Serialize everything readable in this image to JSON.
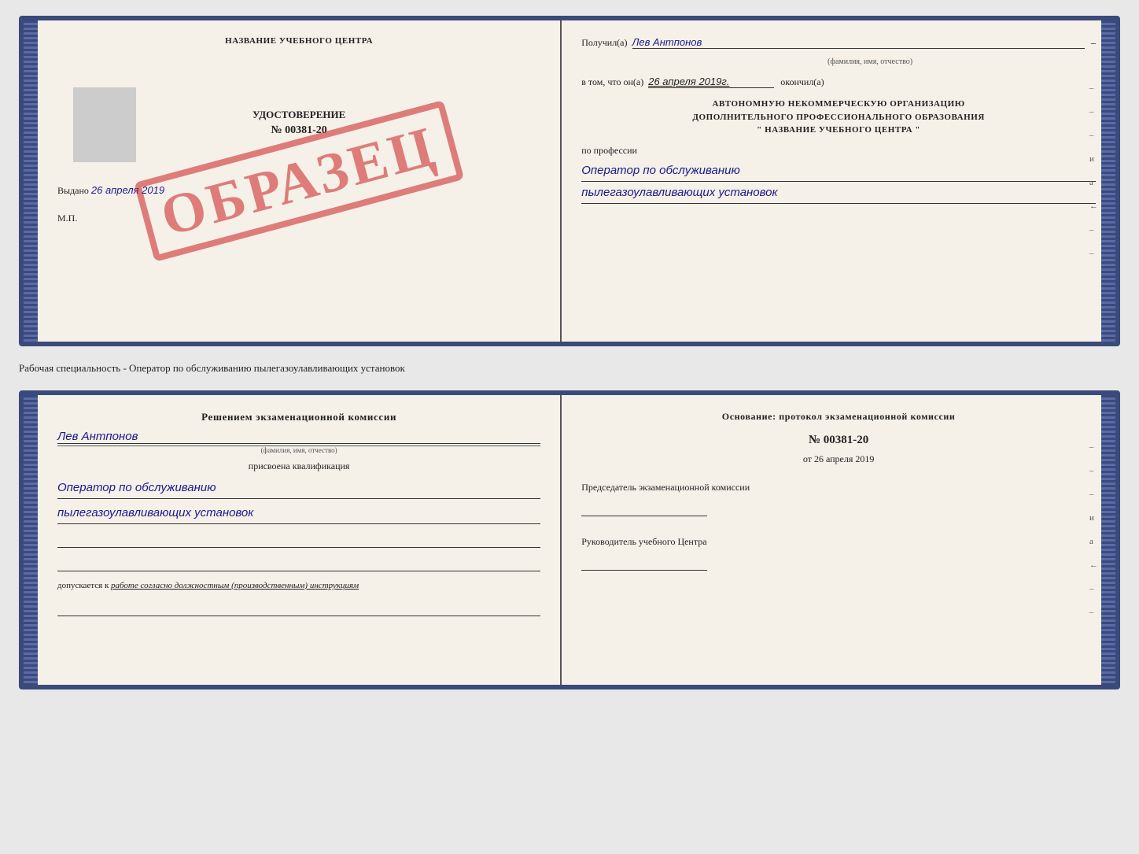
{
  "top_certificate": {
    "left": {
      "title": "НАЗВАНИЕ УЧЕБНОГО ЦЕНТРА",
      "stamp_text": "ОБРАЗЕЦ",
      "photo_placeholder": "",
      "udostoverenie": "УДОСТОВЕРЕНИЕ",
      "number": "№ 00381-20",
      "vydano_label": "Выдано",
      "vydano_date": "26 апреля 2019",
      "mp": "М.П."
    },
    "right": {
      "poluchil_label": "Получил(а)",
      "poluchil_value": "Лев Антпонов",
      "fio_sub": "(фамилия, имя, отчество)",
      "vtom_label": "в том, что он(а)",
      "vtom_date": "26 апреля 2019г.",
      "okonchill_label": "окончил(а)",
      "org_line1": "АВТОНОМНУЮ НЕКОММЕРЧЕСКУЮ ОРГАНИЗАЦИЮ",
      "org_line2": "ДОПОЛНИТЕЛЬНОГО ПРОФЕССИОНАЛЬНОГО ОБРАЗОВАНИЯ",
      "org_line3": "\"  НАЗВАНИЕ УЧЕБНОГО ЦЕНТРА  \"",
      "po_professii": "по профессии",
      "profession_line1": "Оператор по обслуживанию",
      "profession_line2": "пылегазоулавливающих установок"
    }
  },
  "separator": {
    "text": "Рабочая специальность - Оператор по обслуживанию пылегазоулавливающих установок"
  },
  "bottom_certificate": {
    "left": {
      "decision_title": "Решением экзаменационной комиссии",
      "name_value": "Лев Антпонов",
      "fio_sub": "(фамилия, имя, отчество)",
      "prisvoena_label": "присвоена квалификация",
      "qual_line1": "Оператор по обслуживанию",
      "qual_line2": "пылегазоулавливающих установок",
      "dopusk_prefix": "допускается к",
      "dopusk_value": "работе согласно должностным (производственным) инструкциям"
    },
    "right": {
      "osnov_title": "Основание: протокол экзаменационной комиссии",
      "proto_number": "№ 00381-20",
      "proto_date_prefix": "от",
      "proto_date": "26 апреля 2019",
      "predsedatel_title": "Председатель экзаменационной комиссии",
      "rukovoditel_title": "Руководитель учебного Центра"
    }
  },
  "side_marks": {
    "items": [
      "–",
      "–",
      "и",
      "а",
      "←",
      "–",
      "–",
      "–"
    ]
  }
}
